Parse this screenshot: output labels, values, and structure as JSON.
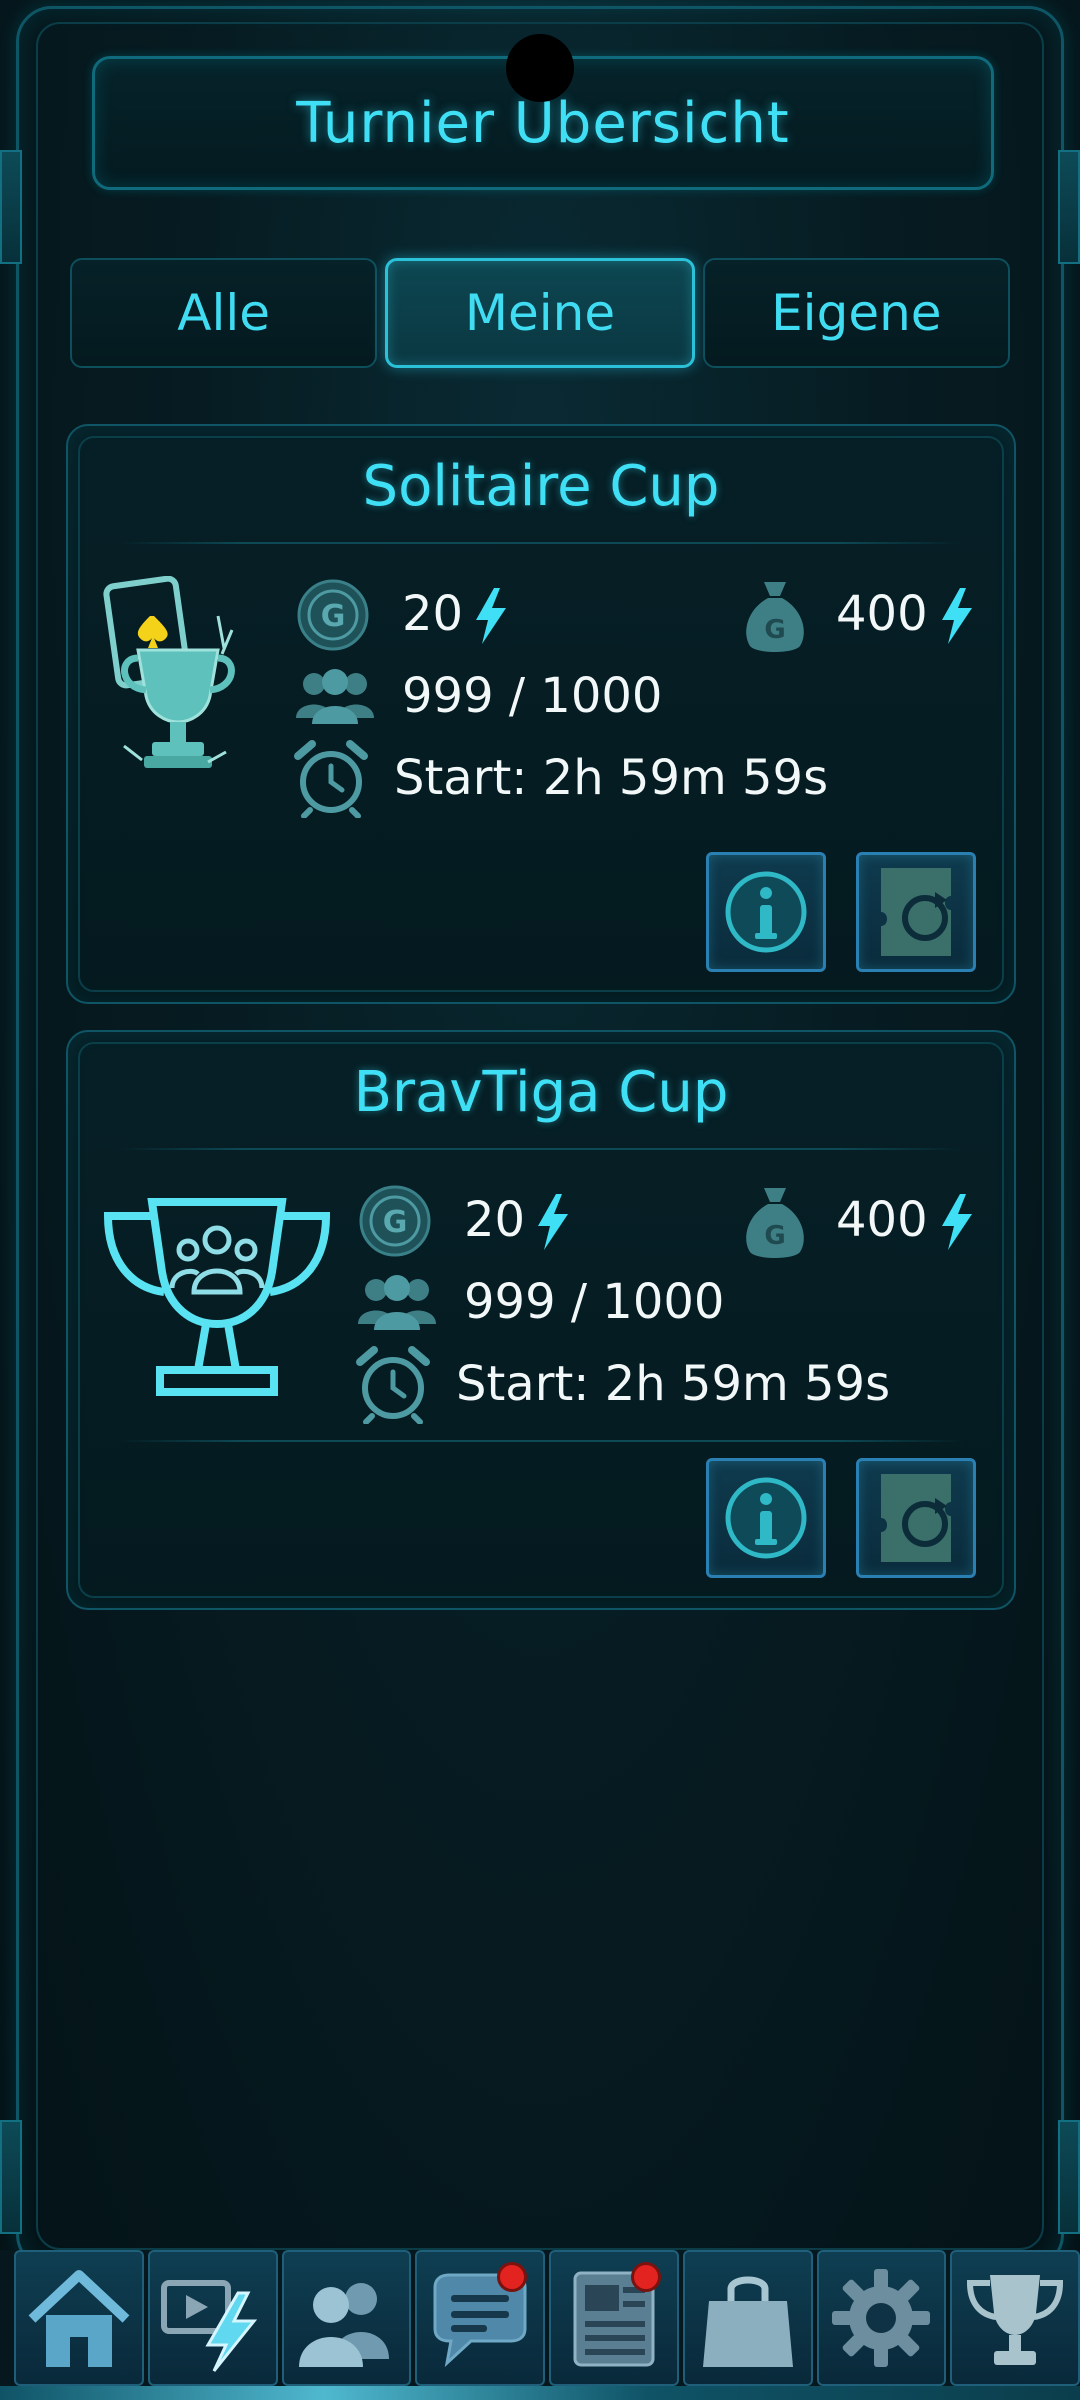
{
  "header": {
    "title": "Turnier Übersicht"
  },
  "tabs": [
    {
      "label": "Alle",
      "active": false
    },
    {
      "label": "Meine",
      "active": true
    },
    {
      "label": "Eigene",
      "active": false
    }
  ],
  "tournaments": [
    {
      "title": "Solitaire Cup",
      "entry_fee": "20",
      "prize": "400",
      "participants": "999 / 1000",
      "start": "Start: 2h 59m 59s",
      "image_icon": "solitaire-trophy-icon"
    },
    {
      "title": "BravTiga Cup",
      "entry_fee": "20",
      "prize": "400",
      "participants": "999 / 1000",
      "start": "Start: 2h 59m 59s",
      "image_icon": "team-trophy-icon"
    }
  ],
  "colors": {
    "accent": "#3fe0f5",
    "text": "#f2f7f8",
    "background": "#041a1f",
    "notification": "#e2231f"
  },
  "nav": [
    {
      "icon": "home-icon",
      "badge": false
    },
    {
      "icon": "video-bolt-icon",
      "badge": false
    },
    {
      "icon": "friends-icon",
      "badge": false
    },
    {
      "icon": "chat-icon",
      "badge": true
    },
    {
      "icon": "news-icon",
      "badge": true
    },
    {
      "icon": "shop-bag-icon",
      "badge": false
    },
    {
      "icon": "settings-gear-icon",
      "badge": false
    },
    {
      "icon": "trophy-icon",
      "badge": false
    }
  ]
}
